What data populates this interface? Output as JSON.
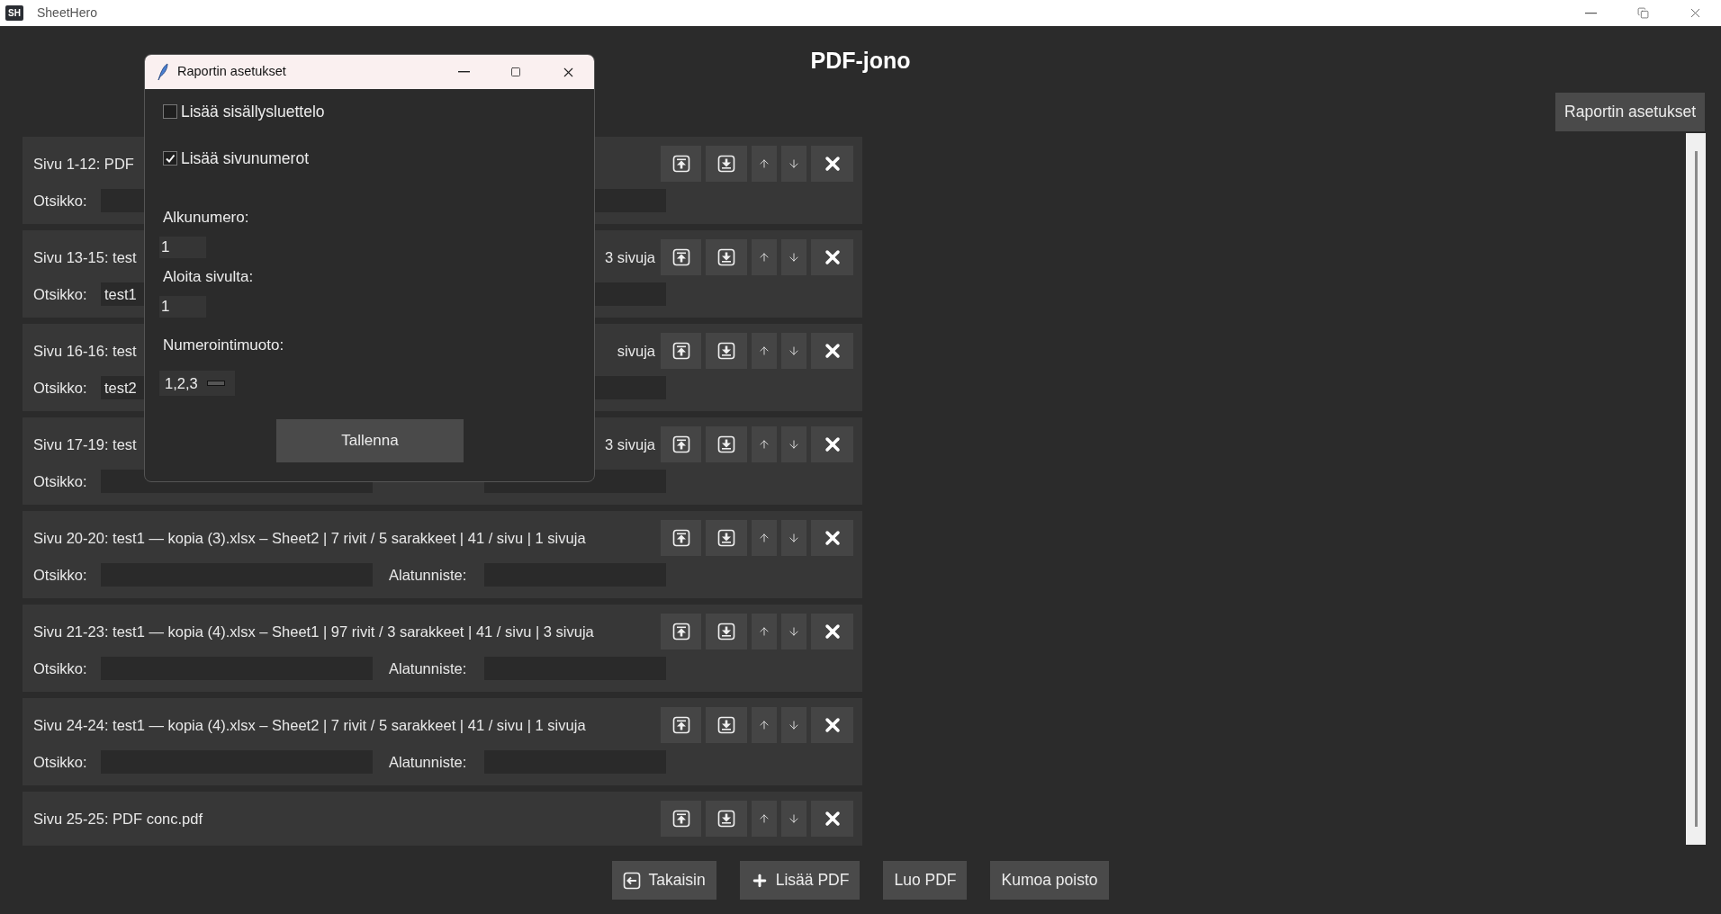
{
  "window": {
    "icon_text": "SH",
    "title": "SheetHero"
  },
  "heading": "PDF-jono",
  "settings_button": "Raportin asetukset",
  "rows": [
    {
      "title": "Sivu 1-12: PDF",
      "header_label": "Otsikko:"
    },
    {
      "title": "Sivu 13-15: test",
      "title_tail": "3 sivuja",
      "header_label": "Otsikko:",
      "header_value": "test1"
    },
    {
      "title": "Sivu 16-16: test",
      "title_tail": "sivuja",
      "header_label": "Otsikko:",
      "header_value": "test2"
    },
    {
      "title": "Sivu 17-19: test",
      "title_tail": "3 sivuja",
      "header_label": "Otsikko:"
    },
    {
      "title": "Sivu 20-20: test1 — kopia (3).xlsx – Sheet2 | 7 rivit / 5 sarakkeet | 41 / sivu | 1 sivuja",
      "header_label": "Otsikko:",
      "footer_label": "Alatunniste:"
    },
    {
      "title": "Sivu 21-23: test1 — kopia (4).xlsx – Sheet1 | 97 rivit / 3 sarakkeet | 41 / sivu | 3 sivuja",
      "header_label": "Otsikko:",
      "footer_label": "Alatunniste:"
    },
    {
      "title": "Sivu 24-24: test1 — kopia (4).xlsx – Sheet2 | 7 rivit / 5 sarakkeet | 41 / sivu | 1 sivuja",
      "header_label": "Otsikko:",
      "footer_label": "Alatunniste:"
    },
    {
      "title": "Sivu 25-25: PDF conc.pdf"
    }
  ],
  "bottom_buttons": [
    {
      "kind": "back",
      "label": "Takaisin"
    },
    {
      "kind": "add",
      "label": "Lisää PDF"
    },
    {
      "kind": "plain",
      "label": "Luo PDF"
    },
    {
      "kind": "plain",
      "label": "Kumoa poisto"
    }
  ],
  "dialog": {
    "title": "Raportin asetukset",
    "checkboxes": [
      {
        "label": "Lisää sisällysluettelo",
        "checked": false
      },
      {
        "label": "Lisää sivunumerot",
        "checked": true
      }
    ],
    "start_number": {
      "label": "Alkunumero:",
      "value": "1"
    },
    "start_page": {
      "label": "Aloita sivulta:",
      "value": "1"
    },
    "format": {
      "label": "Numerointimuoto:",
      "value": "1,2,3"
    },
    "save_button": "Tallenna"
  }
}
